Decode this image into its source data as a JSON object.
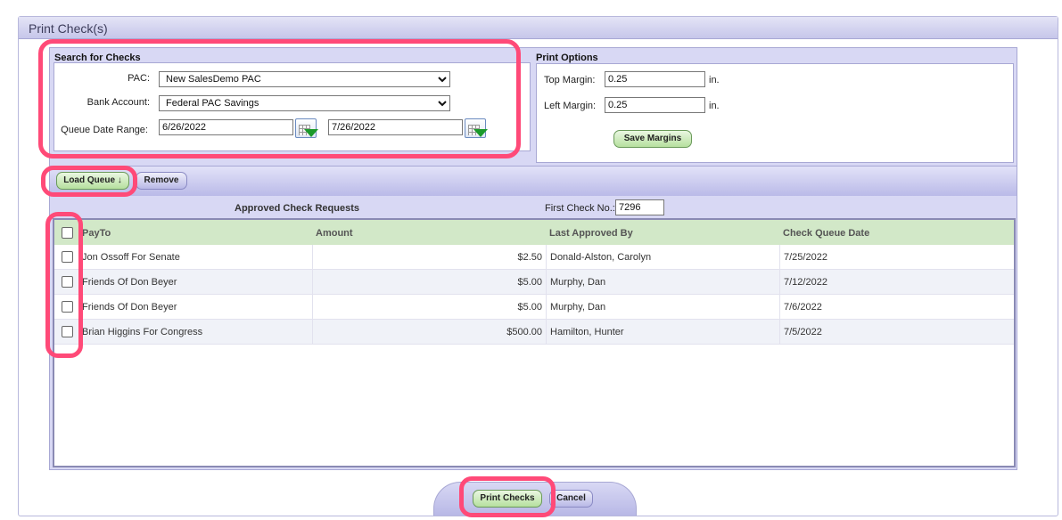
{
  "title": "Print Check(s)",
  "search": {
    "header": "Search for Checks",
    "pac_label": "PAC:",
    "pac_value": "New SalesDemo PAC",
    "bank_label": "Bank Account:",
    "bank_value": "Federal PAC Savings",
    "date_label": "Queue Date Range:",
    "date_from": "6/26/2022",
    "date_to": "7/26/2022"
  },
  "print_options": {
    "header": "Print Options",
    "top_label": "Top Margin:",
    "top_value": "0.25",
    "left_label": "Left Margin:",
    "left_value": "0.25",
    "unit": "in.",
    "save_label": "Save Margins"
  },
  "toolbar": {
    "load_label": "Load Queue ↓",
    "remove_label": "Remove"
  },
  "queue": {
    "title": "Approved Check Requests",
    "first_check_label": "First Check No.:",
    "first_check_value": "7296"
  },
  "table": {
    "columns": [
      "PayTo",
      "Amount",
      "Last Approved By",
      "Check Queue Date"
    ],
    "rows": [
      {
        "payto": "Jon Ossoff For Senate",
        "amount": "$2.50",
        "approver": "Donald-Alston, Carolyn",
        "date": "7/25/2022"
      },
      {
        "payto": "Friends Of Don Beyer",
        "amount": "$5.00",
        "approver": "Murphy, Dan",
        "date": "7/12/2022"
      },
      {
        "payto": "Friends Of Don Beyer",
        "amount": "$5.00",
        "approver": "Murphy, Dan",
        "date": "7/6/2022"
      },
      {
        "payto": "Brian Higgins For Congress",
        "amount": "$500.00",
        "approver": "Hamilton, Hunter",
        "date": "7/5/2022"
      }
    ]
  },
  "footer": {
    "print_label": "Print Checks",
    "cancel_label": "Cancel"
  },
  "colors": {
    "highlight": "#ff4a78",
    "header_green": "#d2e8c8",
    "panel": "#d8d8f4"
  }
}
